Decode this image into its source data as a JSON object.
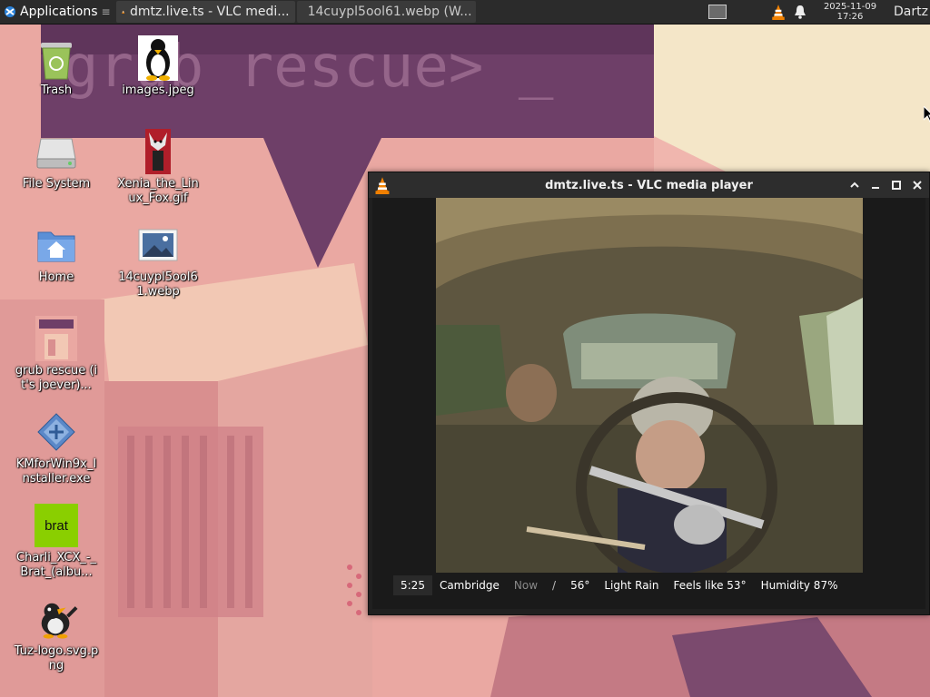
{
  "panel": {
    "apps_label": "Applications",
    "tasks": [
      {
        "label": "dmtz.live.ts - VLC medi...",
        "icon": "vlc-icon",
        "active": true
      },
      {
        "label": "14cuypl5ool61.webp (W...",
        "icon": "firefox-icon",
        "active": false
      }
    ],
    "clock_date": "2025-11-09",
    "clock_time": "17:26",
    "user": "Dartz"
  },
  "wallpaper": {
    "prompt_text": "grub rescue> _"
  },
  "desktop_icons": [
    {
      "label": "Trash",
      "icon": "trash-icon"
    },
    {
      "label": "images.jpeg",
      "icon": "tux-image-icon"
    },
    {
      "label": "File System",
      "icon": "drive-icon"
    },
    {
      "label": "Xenia_the_Linux_Fox.gif",
      "icon": "fox-image-icon"
    },
    {
      "label": "Home",
      "icon": "home-folder-icon"
    },
    {
      "label": "14cuypl5ool61.webp",
      "icon": "image-file-icon"
    },
    {
      "label": "grub rescue (it's joever)...",
      "icon": "wallpaper-image-icon"
    },
    {
      "label": "KMforWin9x_Installer.exe",
      "icon": "exe-icon"
    },
    {
      "label": "Charli_XCX_-_Brat_(albu...",
      "icon": "brat-cover-icon"
    },
    {
      "label": "Tuz-logo.svg.png",
      "icon": "tuz-icon"
    }
  ],
  "vlc": {
    "title": "dmtz.live.ts - VLC media player",
    "ticker": {
      "time": "5:25",
      "city": "Cambridge",
      "now": "Now",
      "temp": "56°",
      "condition": "Light Rain",
      "feels": "Feels like 53°",
      "humidity": "Humidity 87%"
    }
  },
  "colors": {
    "panel_bg": "#2b2b2b",
    "vlc_orange": "#f08000",
    "brat_green": "#8acf00"
  }
}
